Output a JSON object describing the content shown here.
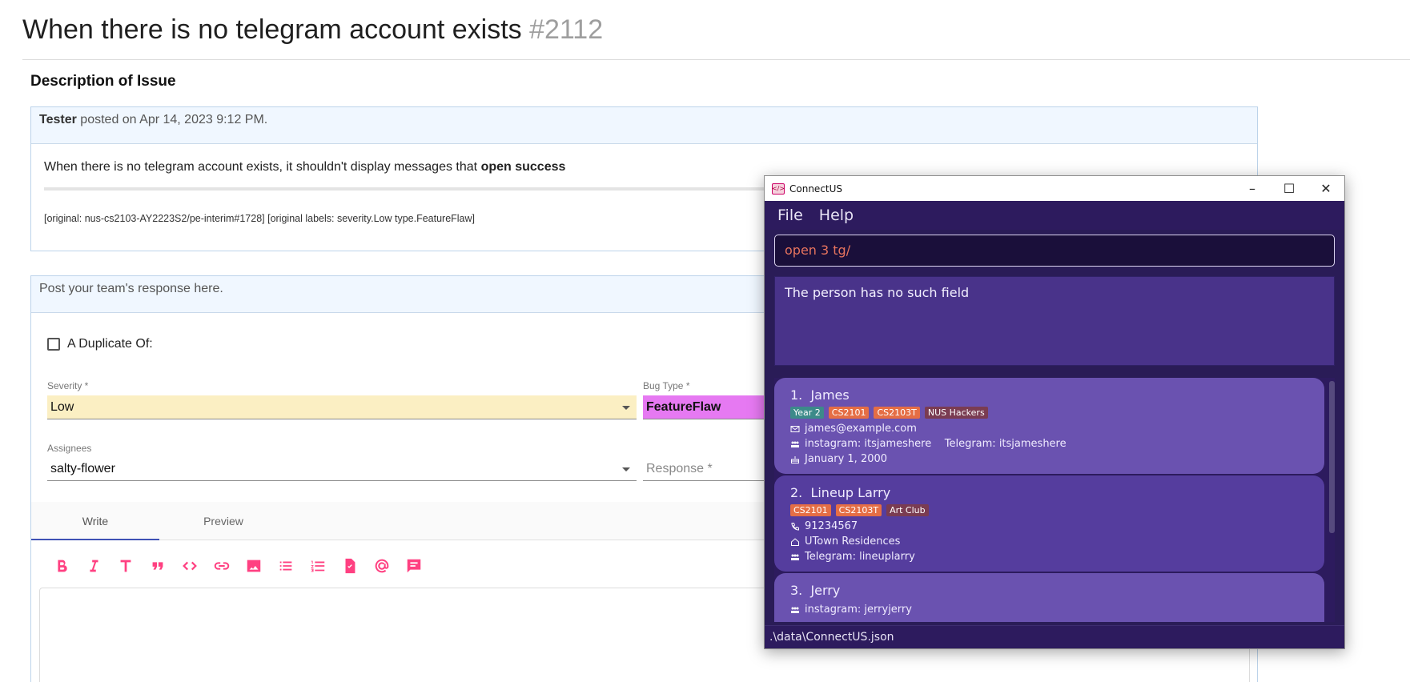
{
  "issue": {
    "title": "When there is no telegram account exists",
    "number": "#2112",
    "section_heading": "Description of Issue"
  },
  "post": {
    "author": "Tester",
    "posted_text": "posted on Apr 14, 2023 9:12 PM.",
    "body_text": "When there is no telegram account exists, it shouldn't display messages that",
    "body_bold": "open success",
    "original_text": "[original: nus-cs2103-AY2223S2/pe-interim#1728] [original labels: severity.Low type.FeatureFlaw]"
  },
  "response": {
    "placeholder": "Post your team's response here.",
    "duplicate_label": "A Duplicate Of:",
    "severity_label": "Severity *",
    "severity_value": "Low",
    "bug_type_label": "Bug Type *",
    "bug_type_value": "FeatureFlaw",
    "assignees_label": "Assignees",
    "assignees_value": "salty-flower",
    "response_placeholder": "Response *",
    "tabs": [
      "Write",
      "Preview"
    ],
    "toolbar_icons": [
      "bold-icon",
      "italic-icon",
      "heading-icon",
      "quote-icon",
      "code-icon",
      "link-icon",
      "image-icon",
      "bulleted-list-icon",
      "numbered-list-icon",
      "task-list-icon",
      "mention-icon",
      "saved-reply-icon"
    ],
    "accent_color": "#ff4081"
  },
  "app": {
    "window_title": "ConnectUS",
    "menu": [
      "File",
      "Help"
    ],
    "command_input": "open 3 tg/",
    "result_text": "The person has no such field",
    "status_path": ".\\data\\ConnectUS.json",
    "persons": [
      {
        "index": "1.",
        "name": "James",
        "tags": [
          {
            "label": "Year 2",
            "color": "#3c8a8a"
          },
          {
            "label": "CS2101",
            "color": "#e56e45"
          },
          {
            "label": "CS2103T",
            "color": "#e56e45"
          },
          {
            "label": "NUS Hackers",
            "color": "#7a3c52"
          }
        ],
        "email": "james@example.com",
        "socials": "instagram: itsjameshere    Telegram: itsjameshere",
        "birthday": "January 1, 2000"
      },
      {
        "index": "2.",
        "name": "Lineup Larry",
        "tags": [
          {
            "label": "CS2101",
            "color": "#e56e45"
          },
          {
            "label": "CS2103T",
            "color": "#e56e45"
          },
          {
            "label": "Art Club",
            "color": "#7a3c52"
          }
        ],
        "phone": "91234567",
        "address": "UTown Residences",
        "socials": "Telegram: lineuplarry"
      },
      {
        "index": "3.",
        "name": "Jerry",
        "socials": "instagram: jerryjerry"
      }
    ]
  }
}
